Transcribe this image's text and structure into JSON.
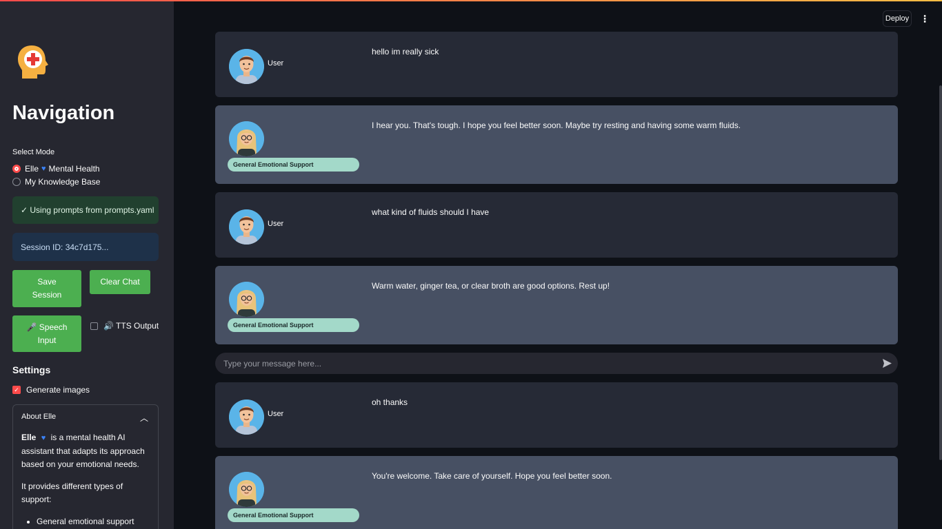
{
  "sidebar": {
    "title": "Navigation",
    "select_label": "Select Mode",
    "modes": [
      {
        "label_a": "Elle",
        "label_b": "Mental Health",
        "selected": true
      },
      {
        "label": "My Knowledge Base",
        "selected": false
      }
    ],
    "success_text": "✓ Using prompts from prompts.yaml",
    "session_text": "Session ID: 34c7d175...",
    "save_label_1": "Save",
    "save_label_2": "Session",
    "clear_label": "Clear Chat",
    "speech_label_1": "🎤 Speech",
    "speech_label_2": "Input",
    "tts_label": "🔊 TTS Output",
    "settings_title": "Settings",
    "generate_images_label": "Generate images",
    "about": {
      "title": "About Elle",
      "name": "Elle",
      "intro": "is a mental health AI assistant that adapts its approach based on your emotional needs.",
      "types_intro": "It provides different types of support:",
      "bullets": [
        "General emotional support and empathy"
      ]
    }
  },
  "header": {
    "deploy_label": "Deploy"
  },
  "chat": {
    "placeholder": "Type your message here...",
    "user_label": "User",
    "badge_label": "General Emotional Support",
    "messages": [
      {
        "role": "user",
        "text": "hello im really sick"
      },
      {
        "role": "assistant",
        "text": "I hear you. That's tough. I hope you feel better soon. Maybe try resting and having some warm fluids."
      },
      {
        "role": "user",
        "text": "what kind of fluids should I have"
      },
      {
        "role": "assistant",
        "text": "Warm water, ginger tea, or clear broth are good options. Rest up!"
      },
      {
        "role": "user",
        "text": "oh thanks"
      },
      {
        "role": "assistant",
        "text": "You're welcome. Take care of yourself. Hope you feel better soon."
      }
    ]
  },
  "colors": {
    "accent": "#ff4b4b",
    "button_green": "#4caf50",
    "badge": "#a3d9c9",
    "user_bubble": "#262a36",
    "bot_bubble": "#475063"
  }
}
